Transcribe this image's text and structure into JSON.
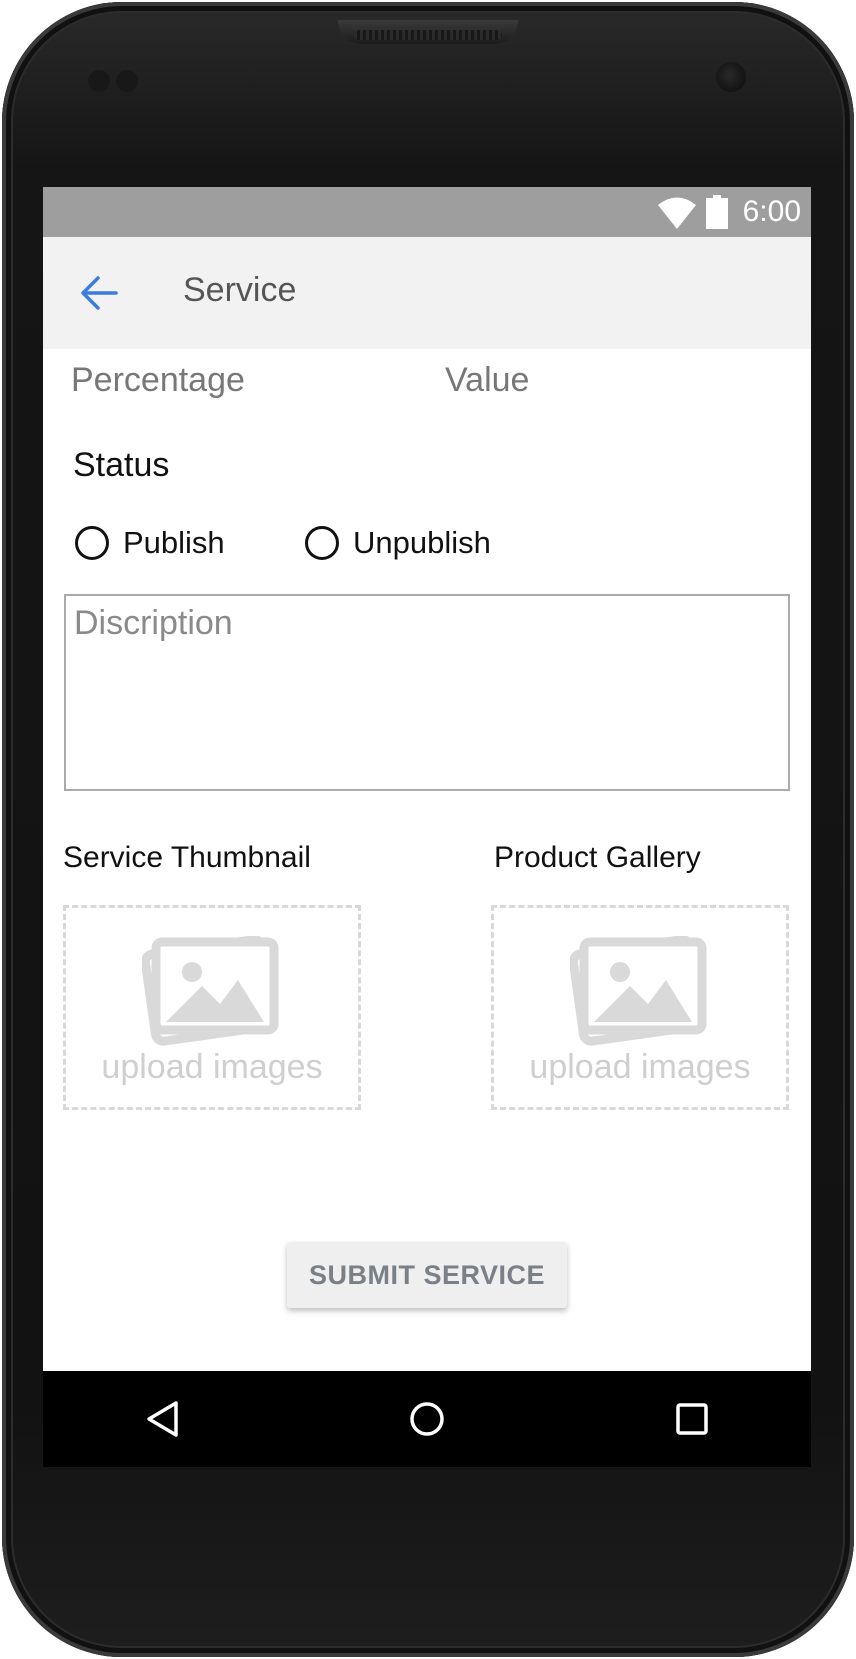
{
  "status_bar": {
    "time": "6:00",
    "icons": [
      "wifi-icon",
      "battery-icon"
    ]
  },
  "app_bar": {
    "title": "Service",
    "back_icon": "arrow-back-icon",
    "accent_color": "#3b7ddd"
  },
  "form": {
    "percentage_label": "Percentage",
    "value_label": "Value",
    "status_heading": "Status",
    "status_options": [
      {
        "label": "Publish",
        "selected": false
      },
      {
        "label": "Unpublish",
        "selected": false
      }
    ],
    "description_placeholder": "Discription",
    "thumbnail_label": "Service Thumbnail",
    "gallery_label": "Product Gallery",
    "thumbnail_upload_text": "upload images",
    "gallery_upload_text": "upload images",
    "submit_label": "SUBMIT SERVICE"
  },
  "nav_bar": {
    "icons": [
      "nav-back-icon",
      "nav-home-icon",
      "nav-recents-icon"
    ]
  }
}
